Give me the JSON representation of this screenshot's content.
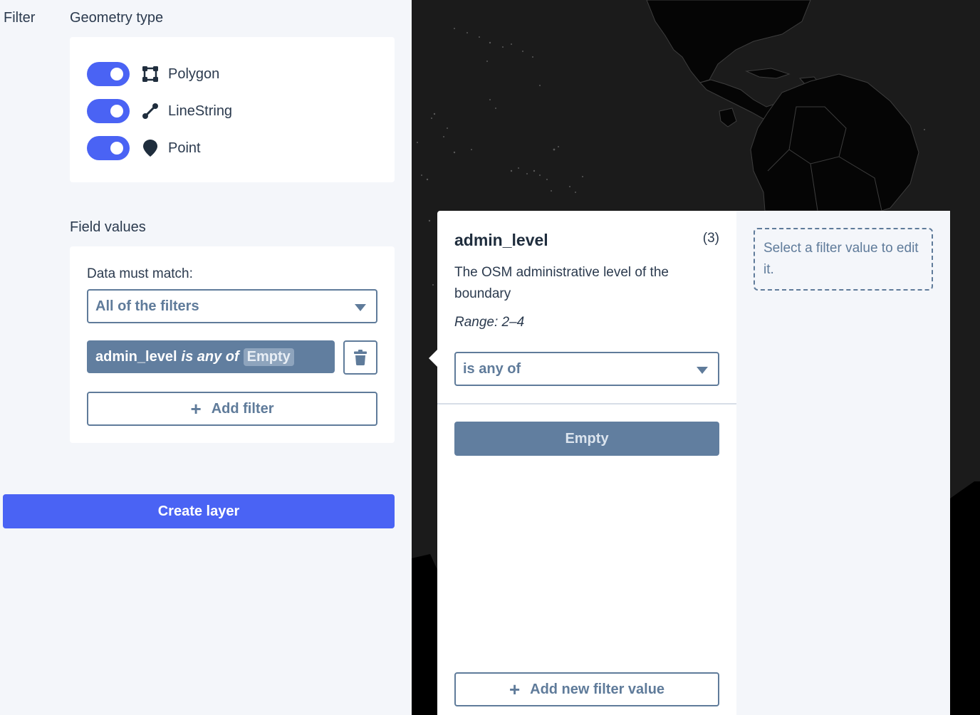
{
  "sidebar": {
    "filter_label": "Filter",
    "geometry_title": "Geometry type",
    "geometry_types": [
      {
        "label": "Polygon",
        "enabled": true,
        "icon": "polygon-icon"
      },
      {
        "label": "LineString",
        "enabled": true,
        "icon": "linestring-icon"
      },
      {
        "label": "Point",
        "enabled": true,
        "icon": "point-icon"
      }
    ],
    "field_values_title": "Field values",
    "match_label": "Data must match:",
    "match_select_value": "All of the filters",
    "filter": {
      "field": "admin_level",
      "operator": "is any of",
      "value": "Empty"
    },
    "add_filter_label": "Add filter",
    "create_layer_label": "Create layer"
  },
  "popover": {
    "field_name": "admin_level",
    "count": "(3)",
    "description": "The OSM administrative level of the boundary",
    "range": "Range: 2–4",
    "operator_select_value": "is any of",
    "value_button_label": "Empty",
    "add_value_label": "Add new filter value",
    "hint": "Select a filter value to edit it."
  },
  "colors": {
    "accent": "#4a63f4",
    "slate": "#5f7b9a",
    "chip": "#617e9f",
    "map_bg": "#1b1b1b",
    "land": "#050505"
  }
}
